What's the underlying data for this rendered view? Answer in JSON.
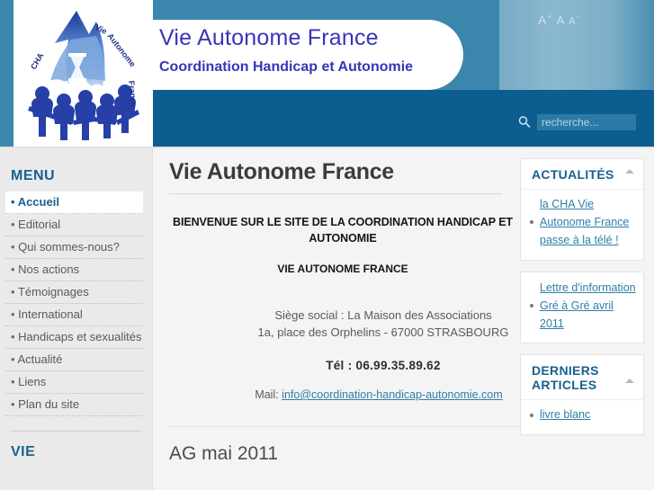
{
  "header": {
    "site_title": "Vie Autonome France",
    "site_subtitle": "Coordination Handicap et Autonomie",
    "logo_alt": "CHA Vie Autonome France",
    "logo_text_cha": "CHA",
    "logo_text_vie": "Vie",
    "logo_text_autonome": "Autonome",
    "logo_text_france": "France",
    "fontsize": {
      "increase": "A",
      "increase_sign": "+",
      "normal": "A",
      "decrease": "A",
      "decrease_sign": "-"
    },
    "search": {
      "placeholder": "recherche...",
      "value": "",
      "icon": "search-icon"
    }
  },
  "sidebar_left": {
    "menu_title": "MENU",
    "items": [
      {
        "label": "Accueil",
        "active": true
      },
      {
        "label": "Editorial",
        "active": false
      },
      {
        "label": "Qui sommes-nous?",
        "active": false
      },
      {
        "label": "Nos actions",
        "active": false
      },
      {
        "label": "Témoignages",
        "active": false
      },
      {
        "label": "International",
        "active": false
      },
      {
        "label": "Handicaps et sexualités",
        "active": false
      },
      {
        "label": "Actualité",
        "active": false
      },
      {
        "label": "Liens",
        "active": false
      },
      {
        "label": "Plan du site",
        "active": false
      }
    ],
    "second_title": "VIE"
  },
  "main": {
    "page_title": "Vie Autonome France",
    "welcome_line1": "BIENVENUE SUR LE SITE DE LA COORDINATION HANDICAP ET AUTONOMIE",
    "welcome_line2": "VIE AUTONOME FRANCE",
    "address_line1": "Siège social : La Maison des Associations",
    "address_line2": "1a, place des Orphelins - 67000 STRASBOURG",
    "phone": "Tél : 06.99.35.89.62",
    "mail_label": "Mail:",
    "mail_address": "info@coordination-handicap-autonomie.com",
    "article_title": "AG mai 2011"
  },
  "sidebar_right": {
    "news_title": "ACTUALITÉS",
    "news_items": [
      {
        "label": "la CHA Vie Autonome France passe à la télé !"
      },
      {
        "label": "Lettre d'information Gré à Gré avril 2011"
      }
    ],
    "articles_title": "DERNIERS ARTICLES",
    "articles_items": [
      {
        "label": "livre blanc"
      }
    ],
    "collapse_icon": "collapse-triangle-icon"
  },
  "colors": {
    "header_blue": "#0b5e8f",
    "mid_blue": "#3b86ad",
    "light_blue": "#8ab8cf",
    "accent_link": "#2e7fa8",
    "heading_blue": "#17628f",
    "title_purple": "#3a34b8",
    "sidebar_bg": "#eaeaea",
    "content_bg": "#f4f4f4"
  }
}
